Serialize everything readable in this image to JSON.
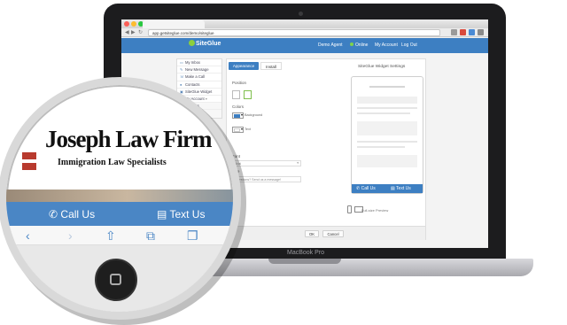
{
  "device": {
    "label": "MacBook Pro"
  },
  "browser": {
    "tab_title": "",
    "url": "app.getsiteglue.com/demo/siteglue",
    "nav_back": "◀",
    "nav_forward": "▶",
    "nav_reload": "↻"
  },
  "header": {
    "logo": "SiteGlue",
    "logo_tagline": "",
    "agent": "Demo Agent",
    "status": "Online",
    "my_account": "My Account",
    "log_out": "Log Out",
    "brand_color": "#3d7fc2"
  },
  "sidebar": {
    "items": [
      {
        "label": "My Inbox",
        "icon": "inbox-icon"
      },
      {
        "label": "New Message",
        "icon": "pencil-icon"
      },
      {
        "label": "Make a Call",
        "icon": "phone-icon"
      },
      {
        "label": "Contacts",
        "icon": "contacts-icon"
      },
      {
        "label": "SiteGlue Widget",
        "icon": "widget-icon"
      },
      {
        "label": "My Account",
        "icon": "user-icon"
      },
      {
        "label": "Devices",
        "icon": ""
      },
      {
        "label": "Voicemail",
        "icon": ""
      }
    ]
  },
  "panel": {
    "tabs": {
      "appearance": "Appearance",
      "install": "Install"
    },
    "title": "SiteGlue Widget Settings",
    "position_label": "Position",
    "colors_label": "Colors",
    "background_label": "Background",
    "text_label": "Text",
    "font_label": "Font",
    "font_value": "Arial",
    "title_label": "Title",
    "title_value": "Questions? Send us a message!",
    "ok": "OK",
    "cancel": "Cancel",
    "fullsize_preview": "Full-size Preview",
    "background_color": "#3d7fc2",
    "text_color": "#ffffff"
  },
  "phone_preview": {
    "call_us": "Call Us",
    "text_us": "Text Us"
  },
  "magnifier": {
    "firm_name": "Joseph Law Firm",
    "firm_subtitle": "Immigration Law Specialists",
    "call_us": "Call Us",
    "text_us": "Text Us"
  }
}
